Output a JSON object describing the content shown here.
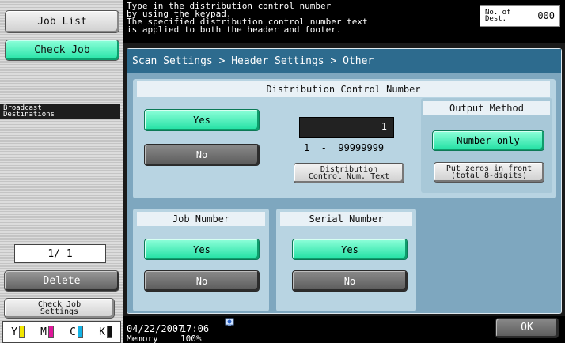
{
  "left_panel": {
    "job_list": "Job List",
    "check_job": "Check Job",
    "broadcast_destinations": "Broadcast\nDestinations",
    "page_counter": "1/ 1",
    "delete": "Delete",
    "check_job_settings": "Check Job\nSettings",
    "toner": [
      {
        "letter": "Y",
        "color": "#f2e600"
      },
      {
        "letter": "M",
        "color": "#e0169a"
      },
      {
        "letter": "C",
        "color": "#12b3e6"
      },
      {
        "letter": "K",
        "color": "#111111"
      }
    ]
  },
  "top_bar": {
    "message": "Type in the distribution control number\nby using the keypad.\nThe specified distribution control number text\nis applied to both the header and footer.",
    "dest_label": "No. of\nDest.",
    "dest_count": "000"
  },
  "breadcrumb": "Scan Settings > Header Settings > Other",
  "distribution_control": {
    "title": "Distribution Control Number",
    "yes": "Yes",
    "no": "No",
    "number_value": "1",
    "range": "1  -  99999999",
    "text_button": "Distribution\nControl Num. Text",
    "output_method": {
      "title": "Output Method",
      "number_only": "Number only",
      "put_zeros": "Put zeros in front\n(total 8-digits)"
    }
  },
  "job_number": {
    "title": "Job Number",
    "yes": "Yes",
    "no": "No"
  },
  "serial_number": {
    "title": "Serial Number",
    "yes": "Yes",
    "no": "No"
  },
  "bottom_bar": {
    "date": "04/22/2007",
    "time": "17:06",
    "memory_label": "Memory",
    "memory_value": "100%",
    "ok": "OK"
  },
  "colors": {
    "accent_green": "#2ee0a8",
    "header_blue": "#2d6b8e",
    "panel_blue": "#7ea7bf"
  },
  "icons": {
    "network": "network-icon"
  }
}
